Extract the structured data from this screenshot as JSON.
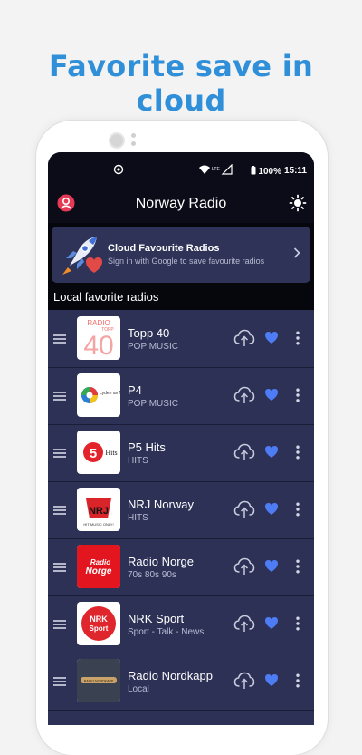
{
  "headline": {
    "line1": "Favorite save in",
    "line2": "cloud"
  },
  "status_bar": {
    "signal": "LTE",
    "battery": "100%",
    "time": "15:11"
  },
  "app_bar": {
    "title": "Norway Radio"
  },
  "cloud_card": {
    "title": "Cloud Favourite Radios",
    "subtitle": "Sign in with Google to save favourite radios"
  },
  "section_title": "Local favorite radios",
  "stations": [
    {
      "name": "Topp 40",
      "genre": "POP MUSIC",
      "logo_text": "RADIO",
      "logo_num": "40",
      "logo_sub": "TOPP"
    },
    {
      "name": "P4",
      "genre": "POP MUSIC",
      "logo_text": "Lyden av Norge"
    },
    {
      "name": "P5 Hits",
      "genre": "HITS",
      "logo_num": "5",
      "logo_text": "Hits"
    },
    {
      "name": "NRJ Norway",
      "genre": "HITS",
      "logo_text": "NRJ",
      "logo_sub": "HIT MUSIC ONLY!"
    },
    {
      "name": "Radio Norge",
      "genre": "70s 80s 90s",
      "logo_text": "Radio",
      "logo_sub": "Norge"
    },
    {
      "name": "NRK Sport",
      "genre": "Sport - Talk - News",
      "logo_text": "NRK",
      "logo_sub": "Sport"
    },
    {
      "name": "Radio Nordkapp",
      "genre": "Local",
      "logo_text": "RADIO NORDKAPP"
    }
  ],
  "colors": {
    "accent": "#2f8fd8",
    "heart": "#4d7cf5",
    "list_bg": "#2d3156",
    "bar_bg": "#0c0c18"
  },
  "icons": [
    "menu-icon",
    "upload-cloud-icon",
    "heart-icon",
    "more-vert-icon",
    "user-icon",
    "sun-icon",
    "chevron-right-icon",
    "wifi-icon",
    "battery-icon"
  ]
}
